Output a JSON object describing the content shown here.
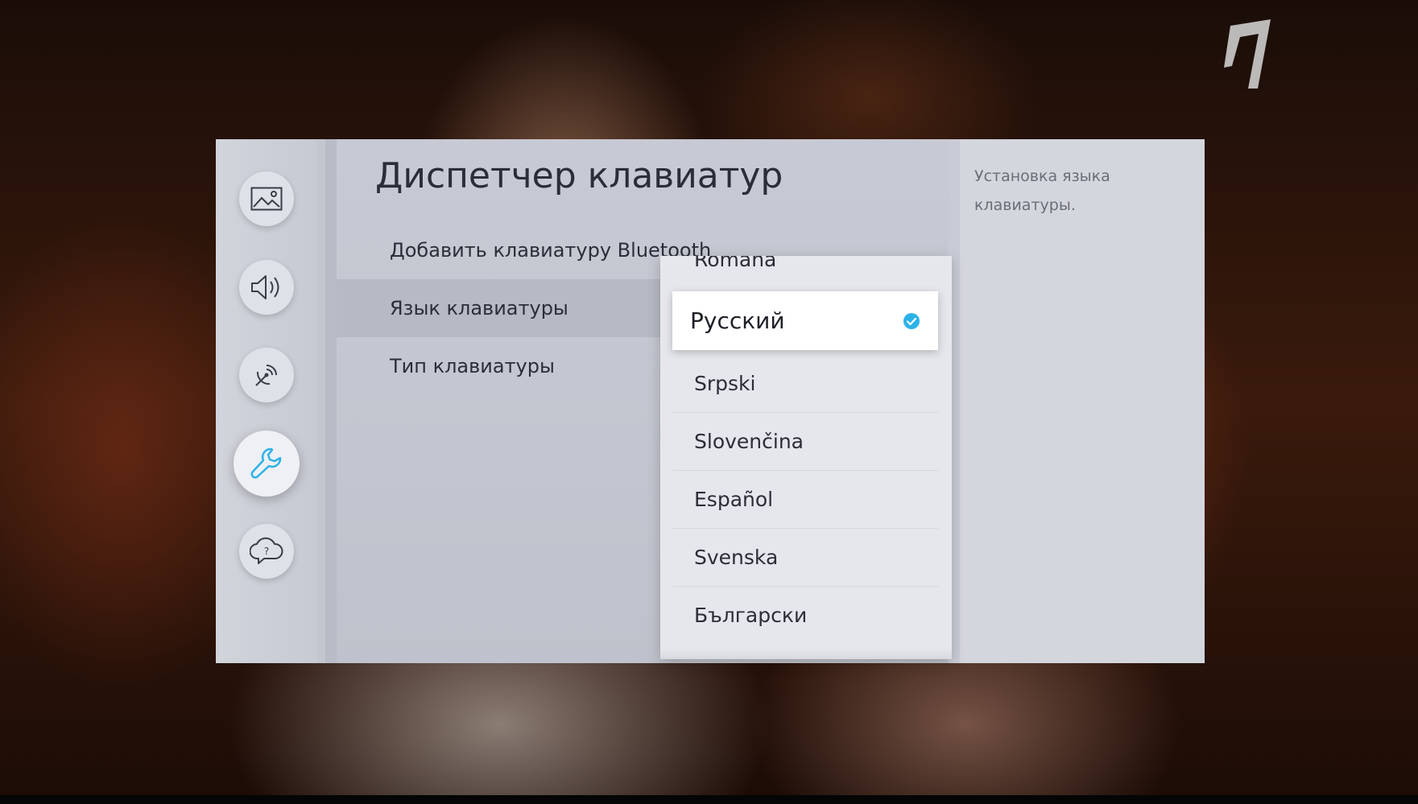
{
  "settings": {
    "title": "Диспетчер клавиатур",
    "help_text": "Установка языка клавиатуры.",
    "menu": [
      {
        "label": "Добавить клавиатуру Bluetooth"
      },
      {
        "label": "Язык клавиатуры",
        "highlighted": true
      },
      {
        "label": "Тип клавиатуры"
      }
    ],
    "sidebar": [
      {
        "icon": "picture-icon"
      },
      {
        "icon": "sound-icon"
      },
      {
        "icon": "broadcast-icon"
      },
      {
        "icon": "wrench-icon",
        "active": true
      },
      {
        "icon": "support-icon"
      }
    ]
  },
  "dropdown": {
    "partial_top": "Română",
    "selected": "Русский",
    "options": [
      "Srpski",
      "Slovenčina",
      "Español",
      "Svenska",
      "Български"
    ]
  },
  "colors": {
    "accent": "#2db2e8",
    "panel": "#c9ccd6",
    "text": "#2b2e38"
  }
}
